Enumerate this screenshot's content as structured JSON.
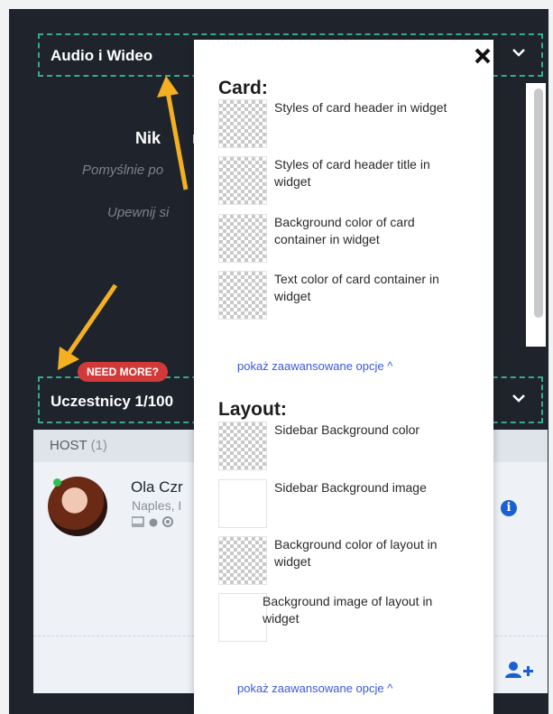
{
  "av_widget": {
    "title": "Audio i Wideo",
    "line1": "Nik",
    "line1b": "m",
    "line2": "Pomyślnie po",
    "line3": "Upewnij si"
  },
  "participants": {
    "badge": "NEED MORE?",
    "title": "Uczestnicy 1/100",
    "host_label": "HOST",
    "host_count": "(1)",
    "participant": {
      "name": "Ola Czr",
      "location": "Naples, I",
      "devices": "□  ◎"
    }
  },
  "popup": {
    "card_title": "Card:",
    "card_items": [
      {
        "label": "Styles of card header in widget"
      },
      {
        "label": "Styles of card header title in widget"
      },
      {
        "label": "Background color of card container in widget"
      },
      {
        "label": "Text color of card container in widget"
      }
    ],
    "advanced_link_1": "pokaż zaawansowane opcje ^",
    "layout_title": "Layout:",
    "layout_items": [
      {
        "label": "Sidebar Background color"
      },
      {
        "label": "Sidebar Background image"
      },
      {
        "label": "Background color of layout in widget"
      },
      {
        "label": "Background image of layout in widget"
      }
    ],
    "advanced_link_2": "pokaż zaawansowane opcje ^"
  },
  "colors": {
    "accent_dashed": "#3aa890",
    "badge_red": "#d23a3a",
    "link_blue": "#3b58d9",
    "arrow_yellow": "#f5b022",
    "dark_bg": "#1f242c"
  },
  "icons": [
    "close-icon",
    "chevron-down-icon",
    "info-icon",
    "add-user-icon",
    "checkerboard-swatch"
  ]
}
